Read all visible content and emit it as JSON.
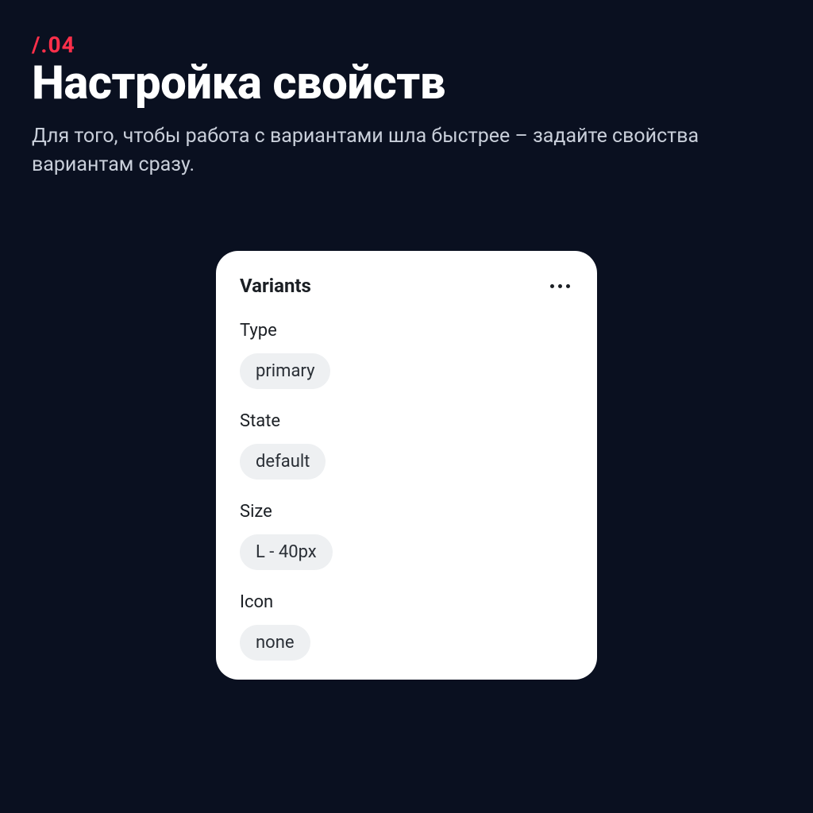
{
  "eyebrow": {
    "slash": "/",
    "dot_num": ".04"
  },
  "title": "Настройка свойств",
  "subtitle": "Для того, чтобы работа с вариантами шла быстрее – задайте свойства вариантам сразу.",
  "panel": {
    "title": "Variants",
    "props": [
      {
        "label": "Type",
        "value": "primary"
      },
      {
        "label": "State",
        "value": "default"
      },
      {
        "label": "Size",
        "value": "L - 40px"
      },
      {
        "label": "Icon",
        "value": "none"
      }
    ]
  },
  "colors": {
    "accent": "#ff2f4a",
    "background": "#0a1020",
    "panel_bg": "#ffffff",
    "chip_bg": "#eef0f2",
    "text_primary": "#ffffff",
    "text_muted": "#c9cfda",
    "panel_text": "#1b1f24"
  }
}
